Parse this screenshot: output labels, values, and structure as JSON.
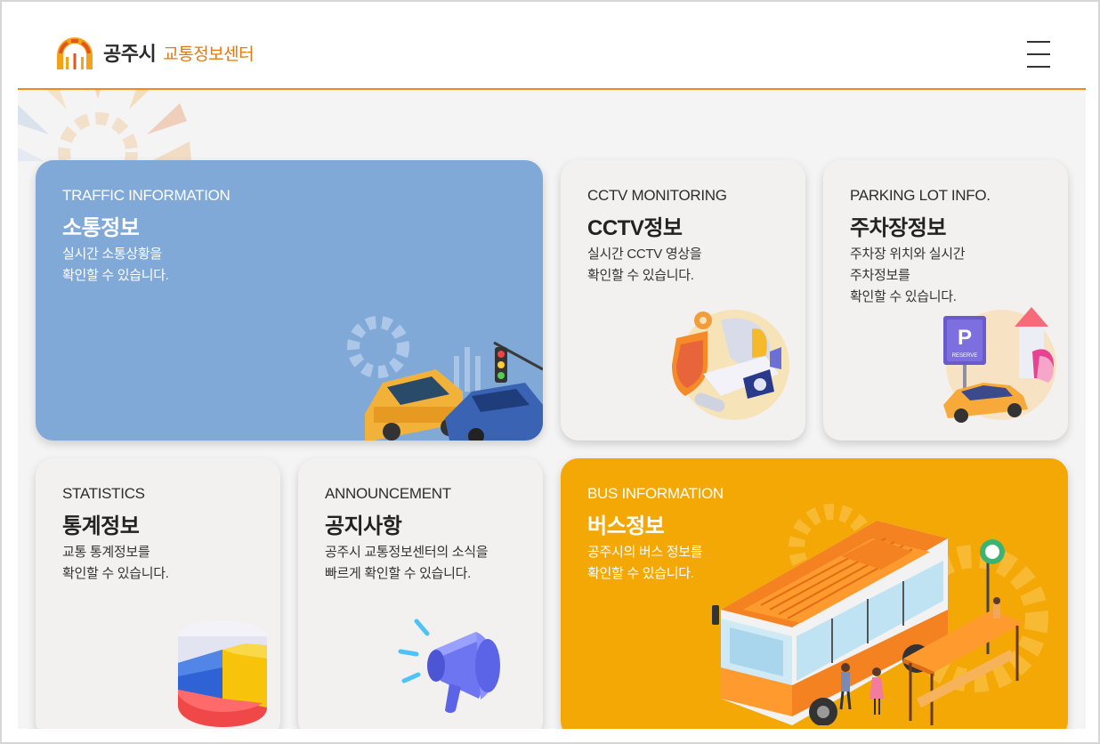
{
  "header": {
    "city": "공주시",
    "subtitle": "교통정보센터"
  },
  "cards": {
    "traffic": {
      "en": "TRAFFIC INFORMATION",
      "ko": "소통정보",
      "desc": "실시간 소통상황을\n확인할 수 있습니다."
    },
    "cctv": {
      "en": "CCTV MONITORING",
      "ko": "CCTV정보",
      "desc": "실시간 CCTV 영상을\n확인할 수 있습니다."
    },
    "parking": {
      "en": "PARKING LOT INFO.",
      "ko": "주차장정보",
      "desc": "주차장 위치와 실시간\n주차정보를\n확인할 수 있습니다."
    },
    "statistics": {
      "en": "STATISTICS",
      "ko": "통계정보",
      "desc": "교통 통계정보를\n확인할 수 있습니다."
    },
    "announcement": {
      "en": "ANNOUNCEMENT",
      "ko": "공지사항",
      "desc": "공주시 교통정보센터의 소식을\n빠르게 확인할 수 있습니다."
    },
    "bus": {
      "en": "BUS INFORMATION",
      "ko": "버스정보",
      "desc": "공주시의 버스 정보를\n확인할 수 있습니다."
    }
  },
  "illustrations": {
    "parking_sign": "P",
    "parking_sign_sub": "RESERVE"
  },
  "colors": {
    "accent": "#f08a1c",
    "traffic_card": "#80a9d8",
    "bus_card": "#f4a806",
    "card_bg": "#f2f1ef"
  },
  "icons": [
    "logo-icon",
    "menu-icon",
    "traffic-illustration",
    "cctv-illustration",
    "parking-illustration",
    "statistics-illustration",
    "megaphone-illustration",
    "bus-illustration"
  ]
}
